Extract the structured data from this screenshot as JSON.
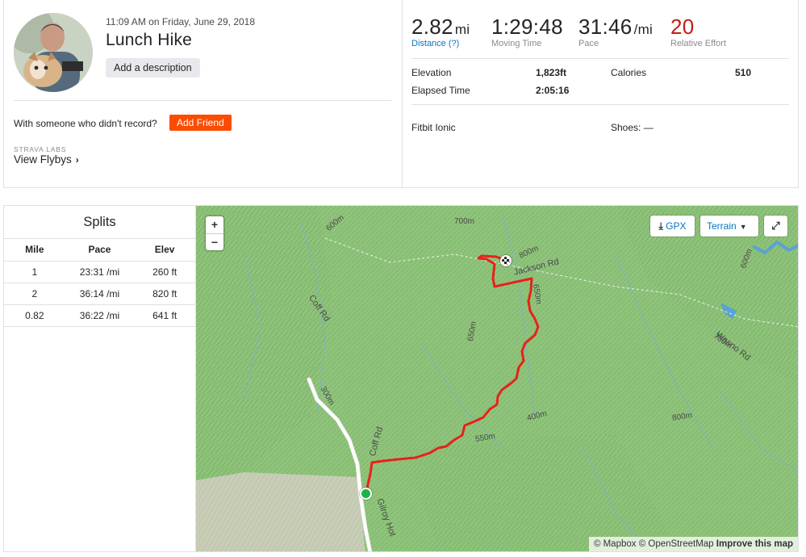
{
  "activity": {
    "datetime": "11:09 AM on Friday, June 29, 2018",
    "title": "Lunch Hike",
    "add_description_label": "Add a description",
    "friend_question": "With someone who didn't record?",
    "add_friend_label": "Add Friend",
    "labs_label": "STRAVA LABS",
    "flybys_label": "View Flybys"
  },
  "stats": {
    "distance": {
      "value": "2.82",
      "unit": "mi",
      "label": "Distance (?)"
    },
    "moving_time": {
      "value": "1:29:48",
      "label": "Moving Time"
    },
    "pace": {
      "value": "31:46",
      "unit": "/mi",
      "label": "Pace"
    },
    "relative_effort": {
      "value": "20",
      "label": "Relative Effort"
    },
    "elevation_label": "Elevation",
    "elevation_value": "1,823ft",
    "calories_label": "Calories",
    "calories_value": "510",
    "elapsed_label": "Elapsed Time",
    "elapsed_value": "2:05:16",
    "device": "Fitbit Ionic",
    "shoes": "Shoes: —"
  },
  "splits": {
    "title": "Splits",
    "headers": [
      "Mile",
      "Pace",
      "Elev"
    ],
    "rows": [
      [
        "1",
        "23:31 /mi",
        "260 ft"
      ],
      [
        "2",
        "36:14 /mi",
        "820 ft"
      ],
      [
        "0.82",
        "36:22 /mi",
        "641 ft"
      ]
    ]
  },
  "map": {
    "zoom_in": "+",
    "zoom_out": "−",
    "gpx_label": "GPX",
    "terrain_label": "Terrain",
    "fullscreen_icon": "expand-icon",
    "attribution_mapbox": "© Mapbox © OpenStreetMap",
    "attribution_improve": "Improve this map",
    "roads": [
      "Jackson Rd",
      "Coff Rd",
      "Wasno Rd",
      "Coff Rd",
      "Gilroy Hot"
    ],
    "contours": [
      "700m",
      "600m",
      "800m",
      "650m",
      "400m",
      "550m",
      "300m",
      "650m",
      "700m",
      "800m",
      "600m"
    ]
  },
  "colors": {
    "brand": "#fc4c02",
    "route": "#e8211a",
    "link": "#0477bd",
    "effort": "#c21d17",
    "terrain_green": "#8fc27a"
  }
}
